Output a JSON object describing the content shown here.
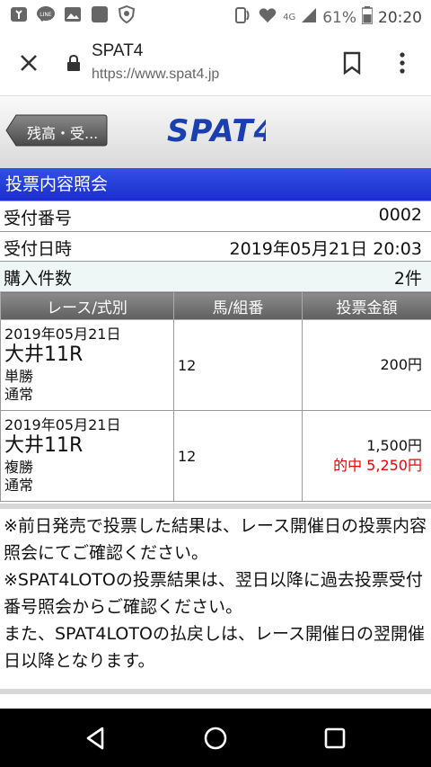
{
  "status_bar": {
    "battery_percent": "61%",
    "time": "20:20",
    "network": "4G",
    "left_icons": [
      "tie-icon",
      "line-icon",
      "image-icon",
      "square-icon",
      "shield-icon"
    ]
  },
  "browser": {
    "site_title": "SPAT4",
    "url": "https://www.spat4.jp"
  },
  "banner": {
    "back_label": "残高・受...",
    "logo_text": "SPAT4"
  },
  "section_title": "投票内容照会",
  "info": [
    {
      "label": "受付番号",
      "value": "0002"
    },
    {
      "label": "受付日時",
      "value": "2019年05月21日 20:03"
    },
    {
      "label": "購入件数",
      "value": "2件"
    }
  ],
  "table": {
    "headers": [
      "レース/式別",
      "馬/組番",
      "投票金額"
    ],
    "rows": [
      {
        "date": "2019年05月21日",
        "race": "大井11R",
        "bet_type": "単勝",
        "mode": "通常",
        "number": "12",
        "amount": "200円",
        "hit": ""
      },
      {
        "date": "2019年05月21日",
        "race": "大井11R",
        "bet_type": "複勝",
        "mode": "通常",
        "number": "12",
        "amount": "1,500円",
        "hit": "的中 5,250円"
      }
    ]
  },
  "notes": [
    "※前日発売で投票した結果は、レース開催日の投票内容照会にてご確認ください。",
    "※SPAT4LOTOの投票結果は、翌日以降に過去投票受付番号照会からご確認ください。",
    "また、SPAT4LOTOの払戻しは、レース開催日の翌開催日以降となります。"
  ],
  "colors": {
    "section_header": "#1a2fc9",
    "logo": "#1a3fb0",
    "hit_text": "#e00000"
  }
}
